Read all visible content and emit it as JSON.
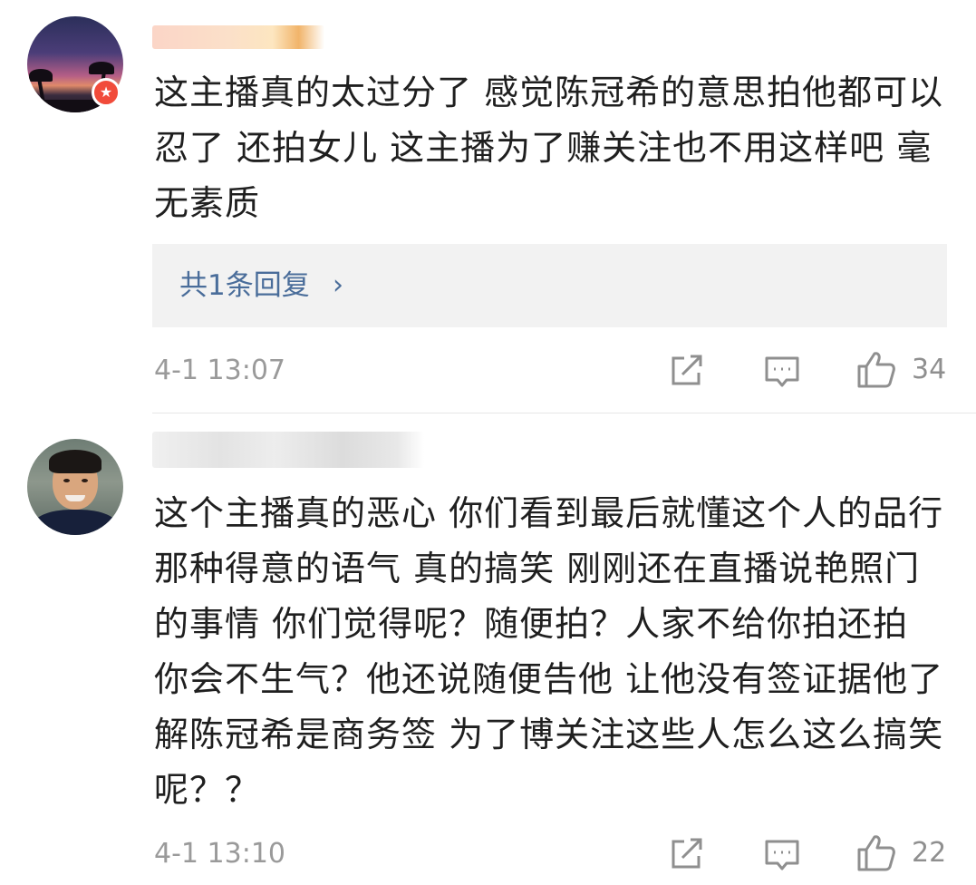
{
  "comments": [
    {
      "text": "这主播真的太过分了 感觉陈冠希的意思拍他都可以忍了 还拍女儿 这主播为了赚关注也不用这样吧 毫无素质",
      "reply_link": "共1条回复",
      "reply_chevron": "›",
      "timestamp": "4-1 13:07",
      "like_count": "34",
      "avatar_icon": "sunset-palm-avatar",
      "badge_icon": "vip-badge-icon"
    },
    {
      "text": "这个主播真的恶心 你们看到最后就懂这个人的品行 那种得意的语气 真的搞笑 刚刚还在直播说艳照门的事情 你们觉得呢？随便拍？人家不给你拍还拍 你会不生气？他还说随便告他 让他没有签证据他了解陈冠希是商务签 为了博关注这些人怎么这么搞笑呢？？",
      "timestamp": "4-1 13:10",
      "like_count": "22",
      "avatar_icon": "boy-avatar"
    }
  ],
  "icons": {
    "share": "share-icon",
    "comment": "comment-icon",
    "like": "thumbs-up-icon"
  },
  "colors": {
    "reply_link": "#4a6d9a",
    "meta_text": "#9a9a9a",
    "badge": "#f14b3a",
    "reply_bg": "#f2f2f2"
  }
}
